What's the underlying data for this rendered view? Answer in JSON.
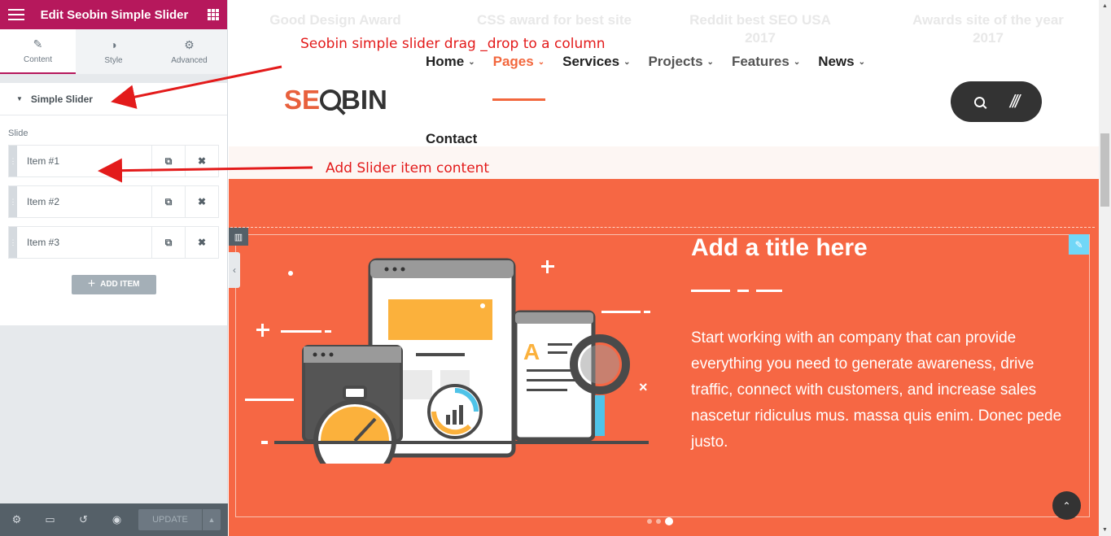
{
  "panel": {
    "title": "Edit Seobin Simple Slider",
    "tabs": [
      {
        "label": "Content",
        "icon": "pencil-icon"
      },
      {
        "label": "Style",
        "icon": "contrast-icon"
      },
      {
        "label": "Advanced",
        "icon": "gear-icon"
      }
    ],
    "section_title": "Simple Slider",
    "field_label": "Slide",
    "items": [
      {
        "label": "Item #1"
      },
      {
        "label": "Item #2"
      },
      {
        "label": "Item #3"
      }
    ],
    "add_item_label": "ADD ITEM",
    "footer": {
      "update_label": "UPDATE"
    }
  },
  "site": {
    "faded_awards": [
      "Good Design Award",
      "CSS award for best site",
      "Reddit best SEO USA 2017",
      "Awards site of the year 2017"
    ],
    "logo": {
      "part1": "SE",
      "part2": "BIN"
    },
    "nav": [
      {
        "label": "Home"
      },
      {
        "label": "Pages"
      },
      {
        "label": "Services"
      },
      {
        "label": "Projects"
      },
      {
        "label": "Features"
      },
      {
        "label": "News"
      }
    ],
    "nav_contact": "Contact"
  },
  "slide": {
    "title": "Add a title here",
    "text": "Start working with an company that can provide everything you need to generate awareness, drive traffic, connect with customers, and increase sales nascetur ridiculus mus. massa quis enim. Donec pede justo."
  },
  "annotations": {
    "drag_note": "Seobin simple slider drag _drop to a column",
    "item_note": "Add Slider item content"
  },
  "colors": {
    "editor_brand": "#b6185c",
    "slider_bg": "#f66744",
    "nav_active": "#f2673d",
    "annotation": "#e31b1b"
  }
}
